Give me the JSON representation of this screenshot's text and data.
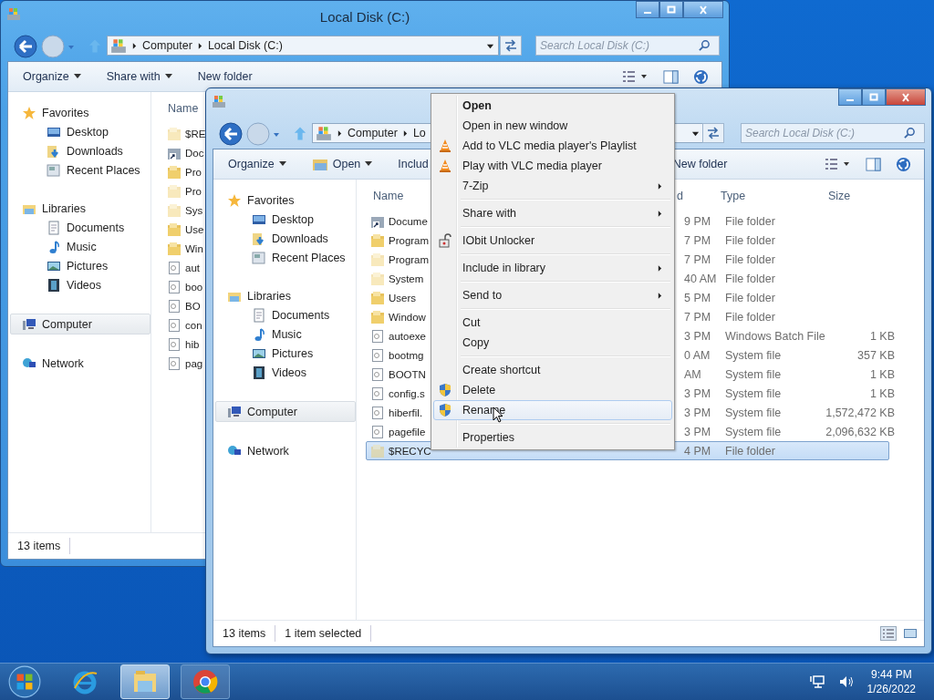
{
  "windows": [
    {
      "title": "Local Disk (C:)",
      "crumbs": [
        "Computer",
        "Local Disk (C:)"
      ],
      "search": {
        "placeholder": "Search Local Disk (C:)"
      },
      "toolbar": [
        {
          "label": "Organize",
          "kind": "menu"
        },
        {
          "label": "Share with",
          "kind": "menu"
        },
        {
          "label": "New folder",
          "kind": "plain"
        }
      ],
      "nav": [
        {
          "label": "Favorites",
          "kind": "star",
          "selected": false,
          "children": [
            {
              "label": "Desktop",
              "kind": "desktop"
            },
            {
              "label": "Downloads",
              "kind": "downloads"
            },
            {
              "label": "Recent Places",
              "kind": "recent"
            }
          ]
        },
        {
          "label": "Libraries",
          "kind": "libraries",
          "selected": false,
          "children": [
            {
              "label": "Documents",
              "kind": "documents"
            },
            {
              "label": "Music",
              "kind": "music"
            },
            {
              "label": "Pictures",
              "kind": "pictures"
            },
            {
              "label": "Videos",
              "kind": "videos"
            }
          ]
        },
        {
          "label": "Computer",
          "kind": "computer",
          "selected": true
        },
        {
          "label": "Network",
          "kind": "network",
          "selected": false
        }
      ],
      "columns": [
        {
          "label": "Name",
          "kind": "name"
        }
      ],
      "rows": [
        {
          "kind": "folder",
          "hidden": true,
          "selected": false,
          "cells": [
            "$RE"
          ]
        },
        {
          "kind": "shortcut",
          "hidden": false,
          "selected": false,
          "cells": [
            "Doc"
          ]
        },
        {
          "kind": "folder",
          "hidden": false,
          "selected": false,
          "cells": [
            "Pro"
          ]
        },
        {
          "kind": "folder",
          "hidden": true,
          "selected": false,
          "cells": [
            "Pro"
          ]
        },
        {
          "kind": "folder",
          "hidden": true,
          "selected": false,
          "cells": [
            "Sys"
          ]
        },
        {
          "kind": "folder",
          "hidden": false,
          "selected": false,
          "cells": [
            "Use"
          ]
        },
        {
          "kind": "folder",
          "hidden": false,
          "selected": false,
          "cells": [
            "Win"
          ]
        },
        {
          "kind": "file",
          "hidden": false,
          "selected": false,
          "cells": [
            "aut"
          ]
        },
        {
          "kind": "file",
          "hidden": false,
          "selected": false,
          "cells": [
            "boo"
          ]
        },
        {
          "kind": "file",
          "hidden": false,
          "selected": false,
          "cells": [
            "BO"
          ]
        },
        {
          "kind": "file",
          "hidden": false,
          "selected": false,
          "cells": [
            "con"
          ]
        },
        {
          "kind": "file",
          "hidden": false,
          "selected": false,
          "cells": [
            "hib"
          ]
        },
        {
          "kind": "file",
          "hidden": false,
          "selected": false,
          "cells": [
            "pag"
          ]
        }
      ],
      "status": [
        "13 items"
      ],
      "view_buttons": false
    },
    {
      "crumbs": [
        "Computer",
        "Lo"
      ],
      "search": {
        "placeholder": "Search Local Disk (C:)"
      },
      "toolbar": [
        {
          "label": "Organize",
          "kind": "menu"
        },
        {
          "label": "Open",
          "kind": "open"
        },
        {
          "label": "Includ",
          "kind": "plain"
        },
        {
          "label": "New folder",
          "kind": "plain"
        }
      ],
      "nav": [
        {
          "label": "Favorites",
          "kind": "star",
          "selected": false,
          "children": [
            {
              "label": "Desktop",
              "kind": "desktop"
            },
            {
              "label": "Downloads",
              "kind": "downloads"
            },
            {
              "label": "Recent Places",
              "kind": "recent"
            }
          ]
        },
        {
          "label": "Libraries",
          "kind": "libraries",
          "selected": false,
          "children": [
            {
              "label": "Documents",
              "kind": "documents"
            },
            {
              "label": "Music",
              "kind": "music"
            },
            {
              "label": "Pictures",
              "kind": "pictures"
            },
            {
              "label": "Videos",
              "kind": "videos"
            }
          ]
        },
        {
          "label": "Computer",
          "kind": "computer",
          "selected": true
        },
        {
          "label": "Network",
          "kind": "network",
          "selected": false
        }
      ],
      "columns": [
        {
          "label": "Name",
          "kind": "name"
        },
        {
          "label": "d",
          "kind": "date"
        },
        {
          "label": "Type",
          "kind": "type"
        },
        {
          "label": "Size",
          "kind": "size"
        }
      ],
      "rows": [
        {
          "kind": "shortcut",
          "hidden": false,
          "selected": false,
          "cells": [
            "Docume",
            "9 PM",
            "File folder",
            ""
          ]
        },
        {
          "kind": "folder",
          "hidden": false,
          "selected": false,
          "cells": [
            "Program",
            "7 PM",
            "File folder",
            ""
          ]
        },
        {
          "kind": "folder",
          "hidden": true,
          "selected": false,
          "cells": [
            "Program",
            "7 PM",
            "File folder",
            ""
          ]
        },
        {
          "kind": "folder",
          "hidden": true,
          "selected": false,
          "cells": [
            "System",
            "40 AM",
            "File folder",
            ""
          ]
        },
        {
          "kind": "folder",
          "hidden": false,
          "selected": false,
          "cells": [
            "Users",
            "5 PM",
            "File folder",
            ""
          ]
        },
        {
          "kind": "folder",
          "hidden": false,
          "selected": false,
          "cells": [
            "Window",
            "7 PM",
            "File folder",
            ""
          ]
        },
        {
          "kind": "file",
          "hidden": false,
          "selected": false,
          "cells": [
            "autoexe",
            "3 PM",
            "Windows Batch File",
            "1 KB"
          ]
        },
        {
          "kind": "file",
          "hidden": false,
          "selected": false,
          "cells": [
            "bootmg",
            "0 AM",
            "System file",
            "357 KB"
          ]
        },
        {
          "kind": "file",
          "hidden": false,
          "selected": false,
          "cells": [
            "BOOTN",
            "AM",
            "System file",
            "1 KB"
          ]
        },
        {
          "kind": "file",
          "hidden": false,
          "selected": false,
          "cells": [
            "config.s",
            "3 PM",
            "System file",
            "1 KB"
          ]
        },
        {
          "kind": "file",
          "hidden": false,
          "selected": false,
          "cells": [
            "hiberfil.",
            "3 PM",
            "System file",
            "1,572,472 KB"
          ]
        },
        {
          "kind": "file",
          "hidden": false,
          "selected": false,
          "cells": [
            "pagefile",
            "3 PM",
            "System file",
            "2,096,632 KB"
          ]
        },
        {
          "kind": "folder",
          "hidden": true,
          "selected": true,
          "cells": [
            "$RECYC",
            "4 PM",
            "File folder",
            ""
          ]
        }
      ],
      "status": [
        "13 items",
        "1 item selected"
      ],
      "view_buttons": true
    }
  ],
  "context_menu": [
    {
      "kind": "plain",
      "label": "Open",
      "bold": true,
      "submenu": false,
      "selected": false
    },
    {
      "kind": "plain",
      "label": "Open in new window",
      "bold": false,
      "submenu": false,
      "selected": false
    },
    {
      "kind": "cone",
      "label": "Add to VLC media player's Playlist",
      "bold": false,
      "submenu": false,
      "selected": false
    },
    {
      "kind": "cone",
      "label": "Play with VLC media player",
      "bold": false,
      "submenu": false,
      "selected": false
    },
    {
      "kind": "plain",
      "label": "7-Zip",
      "bold": false,
      "submenu": true,
      "selected": false
    },
    {
      "kind": "separator"
    },
    {
      "kind": "plain",
      "label": "Share with",
      "bold": false,
      "submenu": true,
      "selected": false
    },
    {
      "kind": "separator"
    },
    {
      "kind": "lock",
      "label": "IObit Unlocker",
      "bold": false,
      "submenu": false,
      "selected": false
    },
    {
      "kind": "separator"
    },
    {
      "kind": "plain",
      "label": "Include in library",
      "bold": false,
      "submenu": true,
      "selected": false
    },
    {
      "kind": "separator"
    },
    {
      "kind": "plain",
      "label": "Send to",
      "bold": false,
      "submenu": true,
      "selected": false
    },
    {
      "kind": "separator"
    },
    {
      "kind": "plain",
      "label": "Cut",
      "bold": false,
      "submenu": false,
      "selected": false
    },
    {
      "kind": "plain",
      "label": "Copy",
      "bold": false,
      "submenu": false,
      "selected": false
    },
    {
      "kind": "separator"
    },
    {
      "kind": "plain",
      "label": "Create shortcut",
      "bold": false,
      "submenu": false,
      "selected": false
    },
    {
      "kind": "shield",
      "label": "Delete",
      "bold": false,
      "submenu": false,
      "selected": false
    },
    {
      "kind": "shield",
      "label": "Rename",
      "bold": false,
      "submenu": false,
      "selected": true
    },
    {
      "kind": "separator"
    },
    {
      "kind": "plain",
      "label": "Properties",
      "bold": false,
      "submenu": false,
      "selected": false
    }
  ],
  "taskbar": {
    "apps": [
      {
        "kind": "ie",
        "running": false,
        "selected": false
      },
      {
        "kind": "explorer",
        "running": true,
        "selected": true
      },
      {
        "kind": "chrome",
        "running": true,
        "selected": false
      }
    ],
    "clock": {
      "time": "9:44 PM",
      "date": "1/26/2022"
    }
  }
}
